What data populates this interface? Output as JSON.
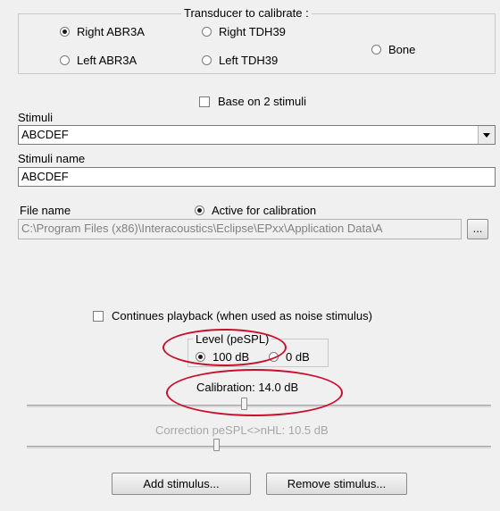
{
  "transducer": {
    "legend": "Transducer to calibrate :",
    "options": [
      "Right ABR3A",
      "Right TDH39",
      "Bone",
      "Left ABR3A",
      "Left TDH39"
    ],
    "selected": "Right ABR3A"
  },
  "base_on_2_stimuli": {
    "label": "Base on 2 stimuli",
    "checked": false
  },
  "stimuli": {
    "label": "Stimuli",
    "value": "ABCDEF"
  },
  "stimuli_name": {
    "label": "Stimuli name",
    "value": "ABCDEF"
  },
  "file": {
    "label": "File name",
    "active_label": "Active for calibration",
    "path": "C:\\Program Files (x86)\\Interacoustics\\Eclipse\\EPxx\\Application Data\\A",
    "browse_label": "..."
  },
  "continuous_playback": {
    "label": "Continues playback (when used as noise stimulus)",
    "checked": false
  },
  "level": {
    "legend": "Level (peSPL)",
    "options": [
      "100 dB",
      "0 dB"
    ],
    "selected": "100 dB"
  },
  "calibration": {
    "label": "Calibration: 14.0 dB"
  },
  "correction": {
    "label": "Correction peSPL<>nHL: 10.5 dB"
  },
  "buttons": {
    "add": "Add stimulus...",
    "remove": "Remove stimulus..."
  },
  "colors": {
    "annotation": "#c8102e",
    "panel": "#f0f0f0"
  }
}
